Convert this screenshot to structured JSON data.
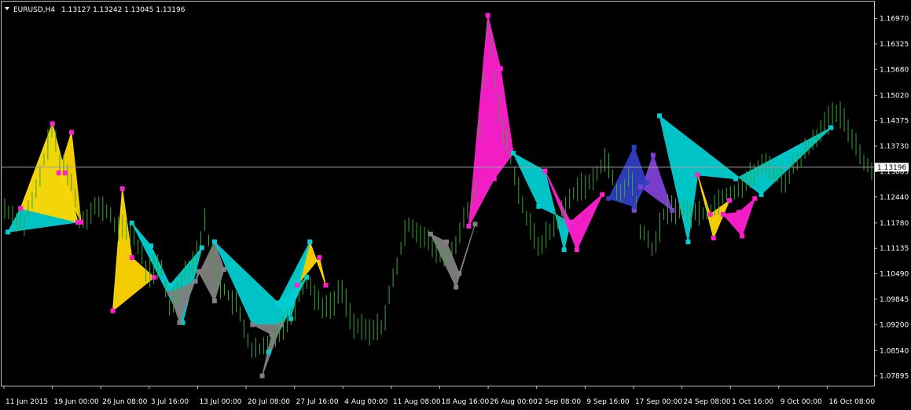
{
  "header": {
    "symbol": "EURUSD,H4",
    "ohlc": "1.13127 1.13242 1.13045 1.13196"
  },
  "colors": {
    "background": "#000000",
    "frame": "#c0c0c0",
    "price_line": "#a0a0a0",
    "bid_label_bg": "#ffffff",
    "bid_label_text": "#000000",
    "bars": "#3aa53a",
    "pattern_colors": [
      "#00ced1",
      "#ffd700",
      "#ff1fd0",
      "#808080",
      "#7f3fd6",
      "#2f3fc0",
      "#ffffff",
      "#32cd32"
    ]
  },
  "chart_data": {
    "type": "ohlc-bars",
    "symbol": "EURUSD",
    "timeframe": "H4",
    "current_price": 1.13196,
    "current_price_label": "1.13196",
    "ylim": [
      1.0765,
      1.174
    ],
    "y_ticks": [
      "1.16970",
      "1.16325",
      "1.15680",
      "1.15020",
      "1.14375",
      "1.13730",
      "1.13085",
      "1.12440",
      "1.11780",
      "1.11135",
      "1.10490",
      "1.09845",
      "1.09200",
      "1.08540",
      "1.07895"
    ],
    "x_ticks": [
      "11 Jun 2015",
      "19 Jun 00:00",
      "26 Jun 08:00",
      "3 Jul 16:00",
      "13 Jul 00:00",
      "20 Jul 08:00",
      "27 Jul 16:00",
      "4 Aug 00:00",
      "11 Aug 08:00",
      "18 Aug 16:00",
      "26 Aug 00:00",
      "2 Sep 08:00",
      "9 Sep 16:00",
      "17 Sep 00:00",
      "24 Sep 08:00",
      "1 Oct 16:00",
      "9 Oct 00:00",
      "16 Oct 08:00"
    ],
    "bar_count": 222,
    "price_path": [
      [
        0,
        1.1215
      ],
      [
        3,
        1.1195
      ],
      [
        6,
        1.1175
      ],
      [
        10,
        1.126
      ],
      [
        15,
        1.1425
      ],
      [
        17,
        1.133
      ],
      [
        20,
        1.131
      ],
      [
        24,
        1.118
      ],
      [
        28,
        1.122
      ],
      [
        32,
        1.121
      ],
      [
        36,
        1.116
      ],
      [
        40,
        1.116
      ],
      [
        45,
        1.105
      ],
      [
        49,
        1.107
      ],
      [
        52,
        1.096
      ],
      [
        56,
        1.1045
      ],
      [
        60,
        1.109
      ],
      [
        63,
        1.118
      ],
      [
        67,
        1.103
      ],
      [
        73,
        1.0965
      ],
      [
        78,
        1.085
      ],
      [
        82,
        1.086
      ],
      [
        86,
        1.0905
      ],
      [
        90,
        1.094
      ],
      [
        95,
        1.104
      ],
      [
        98,
        1.0985
      ],
      [
        102,
        1.096
      ],
      [
        106,
        1.101
      ],
      [
        110,
        1.0915
      ],
      [
        115,
        1.09
      ],
      [
        119,
        1.092
      ],
      [
        123,
        1.106
      ],
      [
        127,
        1.118
      ],
      [
        131,
        1.115
      ],
      [
        135,
        1.111
      ],
      [
        139,
        1.108
      ],
      [
        143,
        1.115
      ],
      [
        148,
        1.126
      ],
      [
        152,
        1.169
      ],
      [
        156,
        1.144
      ],
      [
        160,
        1.132
      ],
      [
        164,
        1.119
      ],
      [
        168,
        1.112
      ],
      [
        172,
        1.116
      ],
      [
        176,
        1.121
      ],
      [
        180,
        1.127
      ],
      [
        185,
        1.128
      ],
      [
        189,
        1.135
      ],
      [
        193,
        1.124
      ],
      [
        197,
        1.13
      ],
      [
        200,
        1.116
      ],
      [
        204,
        1.111
      ],
      [
        208,
        1.1215
      ],
      [
        213,
        1.121
      ],
      [
        217,
        1.12
      ],
      [
        222,
        1.121
      ],
      [
        226,
        1.125
      ],
      [
        230,
        1.126
      ],
      [
        235,
        1.13
      ],
      [
        240,
        1.133
      ],
      [
        245,
        1.128
      ],
      [
        250,
        1.134
      ],
      [
        255,
        1.14
      ],
      [
        262,
        1.146
      ],
      [
        266,
        1.141
      ],
      [
        270,
        1.134
      ],
      [
        273,
        1.1302
      ]
    ],
    "patterns": [
      {
        "color": "#00ced1",
        "pts": [
          [
            1,
            1.1155
          ],
          [
            5,
            1.1215
          ],
          [
            15,
            1.143
          ],
          [
            23,
            1.118
          ]
        ]
      },
      {
        "color": "#ffd700",
        "pts": [
          [
            5,
            1.1215
          ],
          [
            15,
            1.143
          ],
          [
            19,
            1.1305
          ],
          [
            23,
            1.118
          ]
        ]
      },
      {
        "color": "#ffd700",
        "pts": [
          [
            17,
            1.1305
          ],
          [
            21,
            1.1408
          ],
          [
            24,
            1.118
          ]
        ]
      },
      {
        "color": "#ffd700",
        "pts": [
          [
            34,
            1.0955
          ],
          [
            37,
            1.1265
          ],
          [
            40,
            1.109
          ],
          [
            47,
            1.104
          ]
        ]
      },
      {
        "color": "#00ced1",
        "pts": [
          [
            40,
            1.1178
          ],
          [
            46,
            1.112
          ],
          [
            52,
            1.102
          ],
          [
            62,
            1.1115
          ],
          [
            56,
            1.0925
          ]
        ]
      },
      {
        "color": "#808080",
        "pts": [
          [
            52,
            1.1
          ],
          [
            55,
            1.0925
          ],
          [
            61,
            1.1055
          ],
          [
            66,
            1.098
          ],
          [
            69,
            1.106
          ],
          [
            66,
            1.113
          ],
          [
            60,
            1.103
          ]
        ]
      },
      {
        "color": "#00ced1",
        "pts": [
          [
            66,
            1.113
          ],
          [
            78,
            1.092
          ],
          [
            87,
            1.092
          ],
          [
            83,
            1.085
          ],
          [
            95,
            1.104
          ],
          [
            86,
            1.0975
          ]
        ]
      },
      {
        "color": "#808080",
        "pts": [
          [
            78,
            1.092
          ],
          [
            87,
            1.092
          ],
          [
            81,
            1.079
          ],
          [
            84,
            1.0895
          ]
        ]
      },
      {
        "color": "#ffd700",
        "pts": [
          [
            92,
            1.102
          ],
          [
            96,
            1.113
          ],
          [
            101,
            1.102
          ],
          [
            99,
            1.109
          ]
        ]
      },
      {
        "color": "#00ced1",
        "pts": [
          [
            86,
            1.0975
          ],
          [
            96,
            1.113
          ],
          [
            90,
            1.0935
          ]
        ]
      },
      {
        "color": "#808080",
        "pts": [
          [
            134,
            1.115
          ],
          [
            139,
            1.113
          ],
          [
            143,
            1.105
          ],
          [
            148,
            1.1175
          ],
          [
            142,
            1.1015
          ]
        ]
      },
      {
        "color": "#ff1fd0",
        "pts": [
          [
            146,
            1.117
          ],
          [
            152,
            1.1705
          ],
          [
            156,
            1.157
          ],
          [
            160,
            1.1355
          ],
          [
            154,
            1.129
          ]
        ]
      },
      {
        "color": "#00ced1",
        "pts": [
          [
            160,
            1.1355
          ],
          [
            170,
            1.131
          ],
          [
            176,
            1.111
          ],
          [
            178,
            1.118
          ],
          [
            168,
            1.122
          ]
        ]
      },
      {
        "color": "#ff1fd0",
        "pts": [
          [
            170,
            1.131
          ],
          [
            178,
            1.118
          ],
          [
            188,
            1.125
          ],
          [
            180,
            1.111
          ]
        ]
      },
      {
        "color": "#7f3fd6",
        "pts": [
          [
            198,
            1.121
          ],
          [
            204,
            1.135
          ],
          [
            210,
            1.121
          ],
          [
            200,
            1.127
          ]
        ]
      },
      {
        "color": "#2f3fc0",
        "pts": [
          [
            190,
            1.124
          ],
          [
            198,
            1.137
          ],
          [
            202,
            1.128
          ],
          [
            198,
            1.122
          ]
        ]
      },
      {
        "color": "#00ced1",
        "pts": [
          [
            206,
            1.145
          ],
          [
            215,
            1.113
          ],
          [
            218,
            1.13
          ],
          [
            230,
            1.129
          ],
          [
            260,
            1.142
          ],
          [
            238,
            1.125
          ]
        ]
      },
      {
        "color": "#ffd700",
        "pts": [
          [
            218,
            1.13
          ],
          [
            223,
            1.114
          ],
          [
            228,
            1.1235
          ],
          [
            222,
            1.12
          ]
        ]
      },
      {
        "color": "#ff1fd0",
        "pts": [
          [
            226,
            1.12
          ],
          [
            232,
            1.1145
          ],
          [
            236,
            1.124
          ],
          [
            231,
            1.1205
          ]
        ]
      }
    ]
  }
}
